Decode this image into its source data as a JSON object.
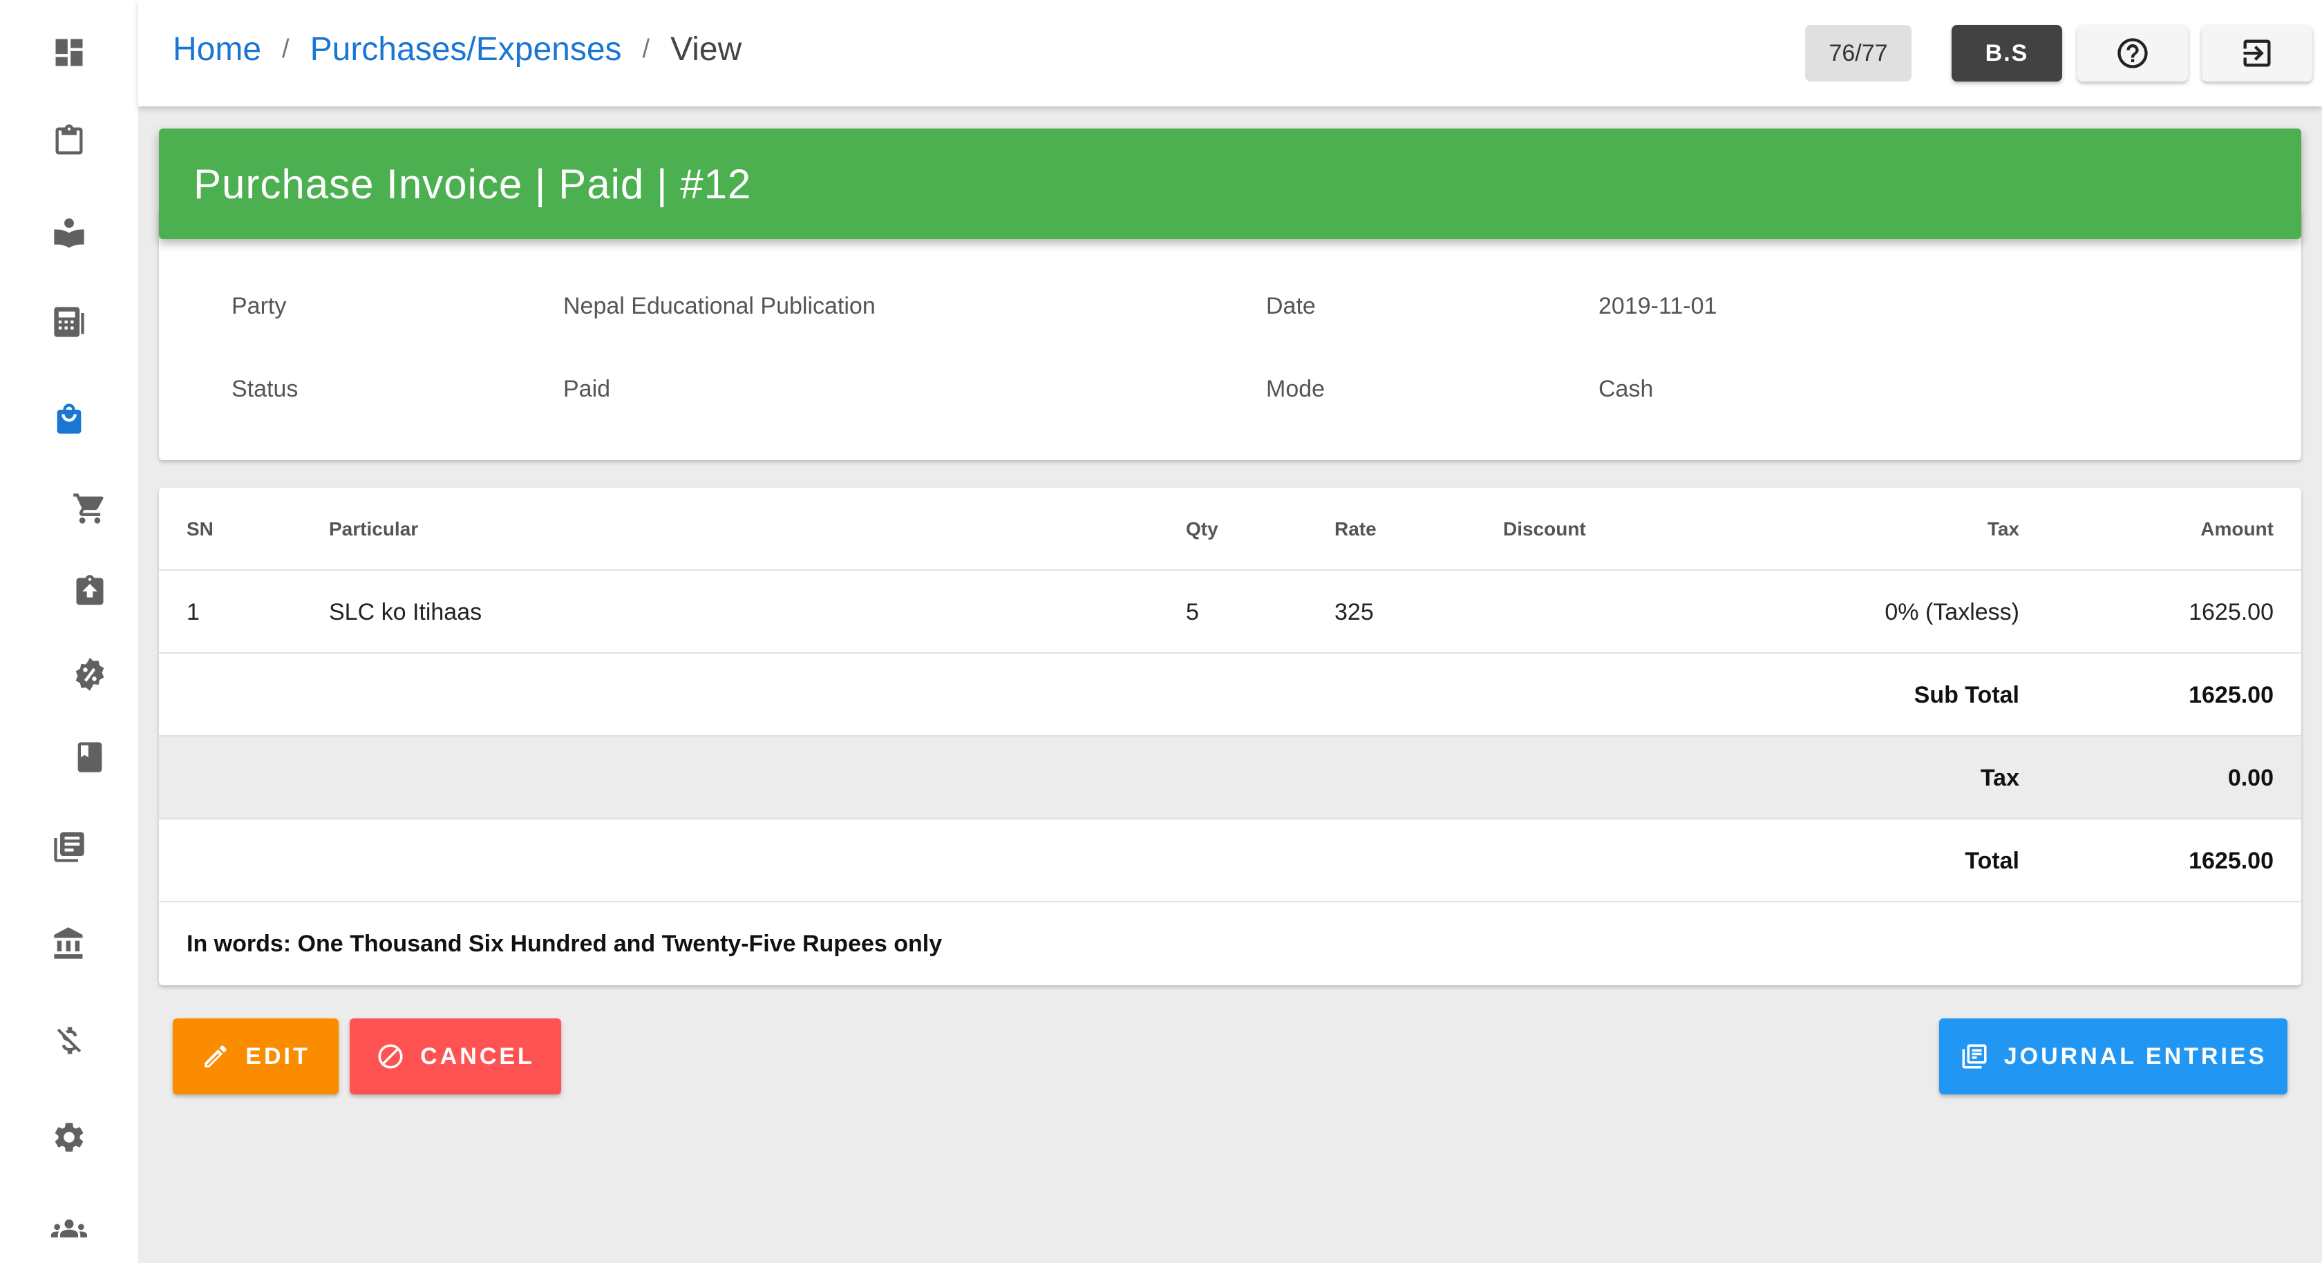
{
  "breadcrumb": {
    "home": "Home",
    "section": "Purchases/Expenses",
    "current": "View",
    "separator": "/"
  },
  "topbar": {
    "counter": "76/77",
    "calendar_toggle": "B.S",
    "help_icon": "help-circle-icon",
    "logout_icon": "logout-icon"
  },
  "sidebar": {
    "items": [
      {
        "icon": "dashboard-icon"
      },
      {
        "icon": "clipboard-icon"
      },
      {
        "icon": "book-reader-icon"
      },
      {
        "icon": "calculator-icon"
      },
      {
        "icon": "shopping-bag-icon",
        "active": true
      },
      {
        "icon": "cart-icon"
      },
      {
        "icon": "clipboard-upload-icon"
      },
      {
        "icon": "discount-icon"
      },
      {
        "icon": "book-icon"
      },
      {
        "icon": "books-stack-icon"
      },
      {
        "icon": "bank-icon"
      },
      {
        "icon": "money-off-icon"
      },
      {
        "icon": "settings-icon"
      },
      {
        "icon": "users-icon"
      }
    ]
  },
  "invoice": {
    "title": "Purchase Invoice | Paid | #12",
    "header_color": "#4caf50",
    "party_label": "Party",
    "party": "Nepal Educational Publication",
    "date_label": "Date",
    "date": "2019-11-01",
    "status_label": "Status",
    "status": "Paid",
    "mode_label": "Mode",
    "mode": "Cash"
  },
  "table": {
    "columns": [
      "SN",
      "Particular",
      "Qty",
      "Rate",
      "Discount",
      "Tax",
      "Amount"
    ],
    "rows": [
      {
        "sn": "1",
        "particular": "SLC ko Itihaas",
        "qty": "5",
        "rate": "325",
        "discount": "",
        "tax": "0% (Taxless)",
        "amount": "1625.00"
      }
    ],
    "subtotal_label": "Sub Total",
    "subtotal": "1625.00",
    "tax_label": "Tax",
    "tax": "0.00",
    "total_label": "Total",
    "total": "1625.00",
    "in_words": "In words: One Thousand Six Hundred and Twenty-Five Rupees only"
  },
  "actions": {
    "edit": "EDIT",
    "cancel": "CANCEL",
    "journal": "JOURNAL ENTRIES",
    "edit_color": "#fb8c00",
    "cancel_color": "#ff5252",
    "journal_color": "#2196f3"
  }
}
